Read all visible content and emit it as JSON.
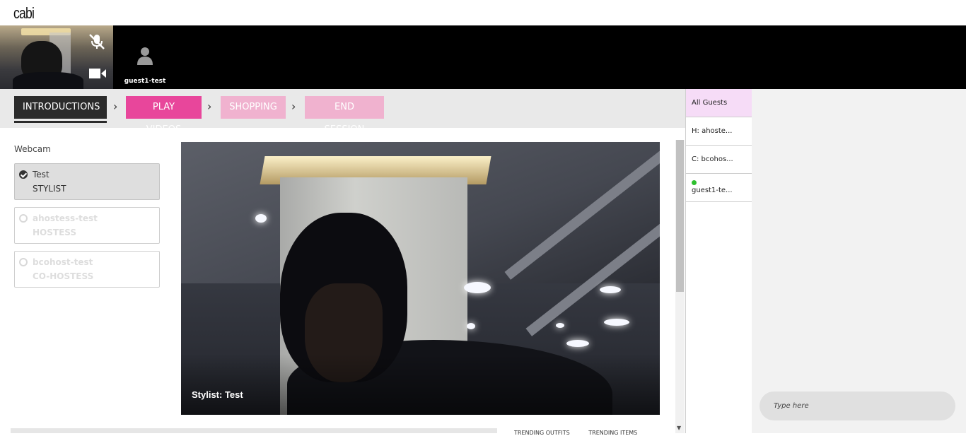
{
  "brand": {
    "logo": "cabi"
  },
  "video_strip": {
    "self": {
      "mute_icon": "mic-muted-icon",
      "camera_icon": "video-camera-icon"
    },
    "guest": {
      "icon": "user-icon",
      "name": "guest1-test"
    }
  },
  "steps": {
    "items": [
      {
        "label": "INTRODUCTIONS",
        "state": "active"
      },
      {
        "label": "PLAY VIDEOS",
        "state": "next"
      },
      {
        "label": "SHOPPING",
        "state": "upcoming"
      },
      {
        "label": "END SESSION",
        "state": "upcoming"
      }
    ],
    "separator_icon": "chevron-right-icon"
  },
  "webcam": {
    "label": "Webcam",
    "people": [
      {
        "name": "Test",
        "role": "STYLIST",
        "selected": true
      },
      {
        "name": "ahostess-test",
        "role": "HOSTESS",
        "selected": false
      },
      {
        "name": "bcohost-test",
        "role": "CO-HOSTESS",
        "selected": false
      }
    ]
  },
  "video": {
    "caption": "Stylist: Test"
  },
  "bottom_tabs": [
    "TRENDING OUTFITS",
    "TRENDING ITEMS"
  ],
  "guests_panel": {
    "items": [
      {
        "label": "All Guests",
        "active": true
      },
      {
        "label": "H: ahoste...",
        "active": false
      },
      {
        "label": "C: bcohos...",
        "active": false
      },
      {
        "label": "guest1-te...",
        "active": false,
        "online": true
      }
    ]
  },
  "chat": {
    "placeholder": "Type here"
  },
  "colors": {
    "active_step": "#2b2b2b",
    "next_step": "#e8469b",
    "upcoming_step": "#f0b2cf",
    "all_guests_bg": "#f6dcf7",
    "online": "#2ec02e"
  }
}
